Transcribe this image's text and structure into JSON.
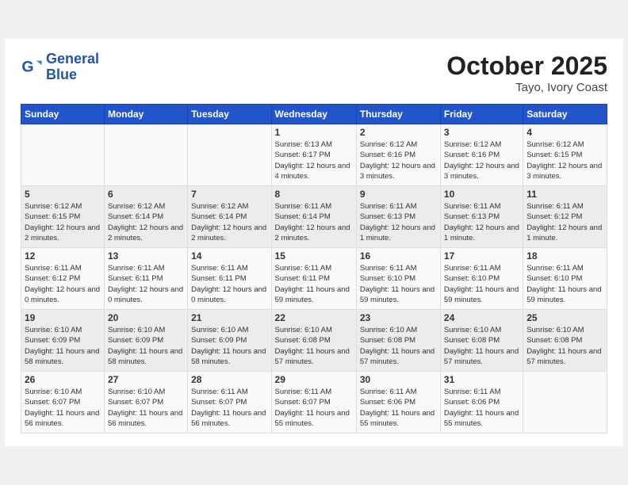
{
  "header": {
    "logo_line1": "General",
    "logo_line2": "Blue",
    "month": "October 2025",
    "location": "Tayo, Ivory Coast"
  },
  "weekdays": [
    "Sunday",
    "Monday",
    "Tuesday",
    "Wednesday",
    "Thursday",
    "Friday",
    "Saturday"
  ],
  "weeks": [
    [
      {
        "day": "",
        "info": ""
      },
      {
        "day": "",
        "info": ""
      },
      {
        "day": "",
        "info": ""
      },
      {
        "day": "1",
        "info": "Sunrise: 6:13 AM\nSunset: 6:17 PM\nDaylight: 12 hours\nand 4 minutes."
      },
      {
        "day": "2",
        "info": "Sunrise: 6:12 AM\nSunset: 6:16 PM\nDaylight: 12 hours\nand 3 minutes."
      },
      {
        "day": "3",
        "info": "Sunrise: 6:12 AM\nSunset: 6:16 PM\nDaylight: 12 hours\nand 3 minutes."
      },
      {
        "day": "4",
        "info": "Sunrise: 6:12 AM\nSunset: 6:15 PM\nDaylight: 12 hours\nand 3 minutes."
      }
    ],
    [
      {
        "day": "5",
        "info": "Sunrise: 6:12 AM\nSunset: 6:15 PM\nDaylight: 12 hours\nand 2 minutes."
      },
      {
        "day": "6",
        "info": "Sunrise: 6:12 AM\nSunset: 6:14 PM\nDaylight: 12 hours\nand 2 minutes."
      },
      {
        "day": "7",
        "info": "Sunrise: 6:12 AM\nSunset: 6:14 PM\nDaylight: 12 hours\nand 2 minutes."
      },
      {
        "day": "8",
        "info": "Sunrise: 6:11 AM\nSunset: 6:14 PM\nDaylight: 12 hours\nand 2 minutes."
      },
      {
        "day": "9",
        "info": "Sunrise: 6:11 AM\nSunset: 6:13 PM\nDaylight: 12 hours\nand 1 minute."
      },
      {
        "day": "10",
        "info": "Sunrise: 6:11 AM\nSunset: 6:13 PM\nDaylight: 12 hours\nand 1 minute."
      },
      {
        "day": "11",
        "info": "Sunrise: 6:11 AM\nSunset: 6:12 PM\nDaylight: 12 hours\nand 1 minute."
      }
    ],
    [
      {
        "day": "12",
        "info": "Sunrise: 6:11 AM\nSunset: 6:12 PM\nDaylight: 12 hours\nand 0 minutes."
      },
      {
        "day": "13",
        "info": "Sunrise: 6:11 AM\nSunset: 6:11 PM\nDaylight: 12 hours\nand 0 minutes."
      },
      {
        "day": "14",
        "info": "Sunrise: 6:11 AM\nSunset: 6:11 PM\nDaylight: 12 hours\nand 0 minutes."
      },
      {
        "day": "15",
        "info": "Sunrise: 6:11 AM\nSunset: 6:11 PM\nDaylight: 11 hours\nand 59 minutes."
      },
      {
        "day": "16",
        "info": "Sunrise: 6:11 AM\nSunset: 6:10 PM\nDaylight: 11 hours\nand 59 minutes."
      },
      {
        "day": "17",
        "info": "Sunrise: 6:11 AM\nSunset: 6:10 PM\nDaylight: 11 hours\nand 59 minutes."
      },
      {
        "day": "18",
        "info": "Sunrise: 6:11 AM\nSunset: 6:10 PM\nDaylight: 11 hours\nand 59 minutes."
      }
    ],
    [
      {
        "day": "19",
        "info": "Sunrise: 6:10 AM\nSunset: 6:09 PM\nDaylight: 11 hours\nand 58 minutes."
      },
      {
        "day": "20",
        "info": "Sunrise: 6:10 AM\nSunset: 6:09 PM\nDaylight: 11 hours\nand 58 minutes."
      },
      {
        "day": "21",
        "info": "Sunrise: 6:10 AM\nSunset: 6:09 PM\nDaylight: 11 hours\nand 58 minutes."
      },
      {
        "day": "22",
        "info": "Sunrise: 6:10 AM\nSunset: 6:08 PM\nDaylight: 11 hours\nand 57 minutes."
      },
      {
        "day": "23",
        "info": "Sunrise: 6:10 AM\nSunset: 6:08 PM\nDaylight: 11 hours\nand 57 minutes."
      },
      {
        "day": "24",
        "info": "Sunrise: 6:10 AM\nSunset: 6:08 PM\nDaylight: 11 hours\nand 57 minutes."
      },
      {
        "day": "25",
        "info": "Sunrise: 6:10 AM\nSunset: 6:08 PM\nDaylight: 11 hours\nand 57 minutes."
      }
    ],
    [
      {
        "day": "26",
        "info": "Sunrise: 6:10 AM\nSunset: 6:07 PM\nDaylight: 11 hours\nand 56 minutes."
      },
      {
        "day": "27",
        "info": "Sunrise: 6:10 AM\nSunset: 6:07 PM\nDaylight: 11 hours\nand 56 minutes."
      },
      {
        "day": "28",
        "info": "Sunrise: 6:11 AM\nSunset: 6:07 PM\nDaylight: 11 hours\nand 56 minutes."
      },
      {
        "day": "29",
        "info": "Sunrise: 6:11 AM\nSunset: 6:07 PM\nDaylight: 11 hours\nand 55 minutes."
      },
      {
        "day": "30",
        "info": "Sunrise: 6:11 AM\nSunset: 6:06 PM\nDaylight: 11 hours\nand 55 minutes."
      },
      {
        "day": "31",
        "info": "Sunrise: 6:11 AM\nSunset: 6:06 PM\nDaylight: 11 hours\nand 55 minutes."
      },
      {
        "day": "",
        "info": ""
      }
    ]
  ]
}
